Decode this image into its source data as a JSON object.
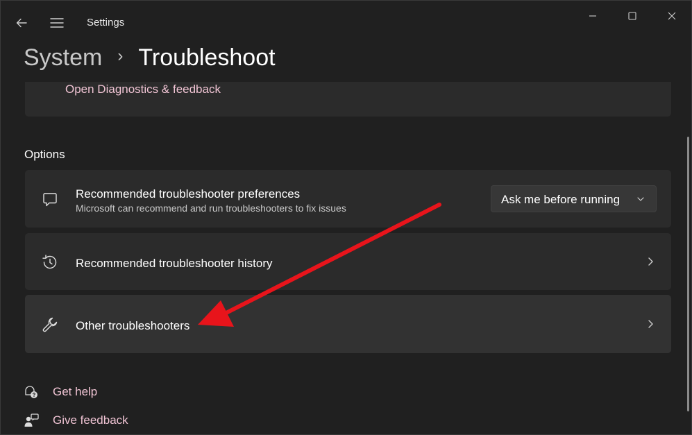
{
  "app": {
    "title": "Settings"
  },
  "breadcrumb": {
    "parent": "System",
    "separator": "›",
    "current": "Troubleshoot"
  },
  "top_card": {
    "link": "Open Diagnostics & feedback"
  },
  "options": {
    "heading": "Options",
    "preferences": {
      "title": "Recommended troubleshooter preferences",
      "subtitle": "Microsoft can recommend and run troubleshooters to fix issues",
      "dropdown_value": "Ask me before running"
    },
    "history": {
      "title": "Recommended troubleshooter history"
    },
    "other": {
      "title": "Other troubleshooters"
    }
  },
  "footer": {
    "get_help": "Get help",
    "give_feedback": "Give feedback"
  },
  "colors": {
    "background": "#202020",
    "card": "#2b2b2b",
    "link": "#f0c4d4",
    "annotation_arrow": "#e8141b"
  },
  "icons": {
    "back": "back-arrow-icon",
    "menu": "hamburger-menu-icon",
    "minimize": "minimize-icon",
    "maximize": "maximize-icon",
    "close": "close-icon",
    "preferences": "chat-bubble-icon",
    "history": "history-icon",
    "other": "wrench-icon",
    "get_help": "help-chat-icon",
    "give_feedback": "feedback-person-icon"
  }
}
